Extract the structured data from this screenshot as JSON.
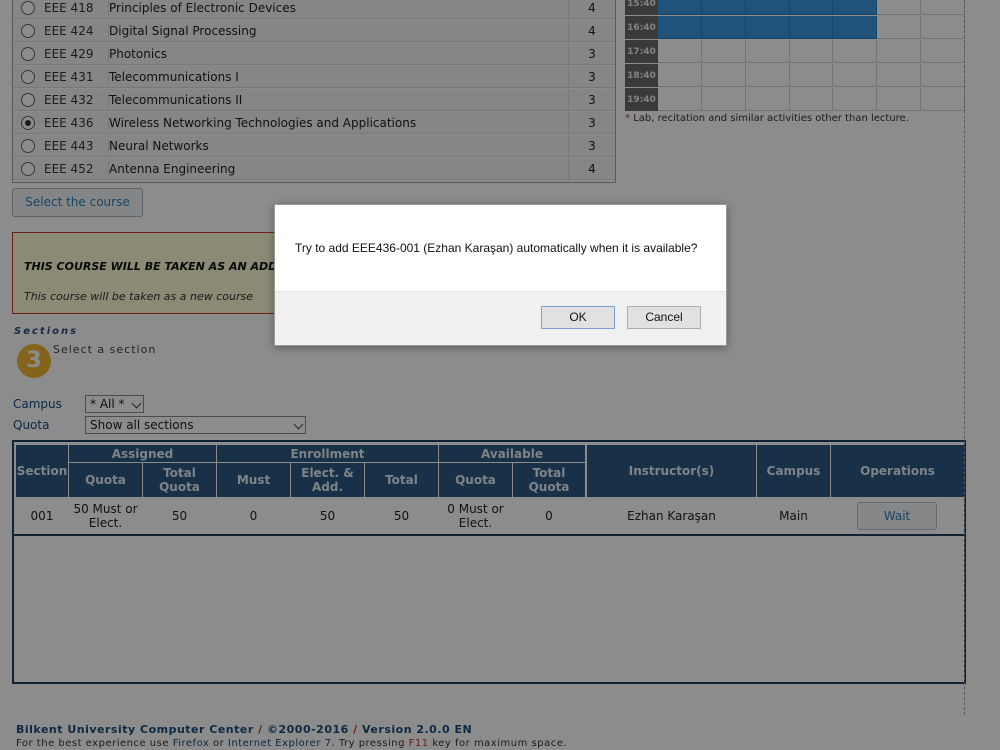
{
  "courses": [
    {
      "code": "EEE 418",
      "name": "Principles of Electronic Devices",
      "credit": "4",
      "selected": false
    },
    {
      "code": "EEE 424",
      "name": "Digital Signal Processing",
      "credit": "4",
      "selected": false
    },
    {
      "code": "EEE 429",
      "name": "Photonics",
      "credit": "3",
      "selected": false
    },
    {
      "code": "EEE 431",
      "name": "Telecommunications I",
      "credit": "3",
      "selected": false
    },
    {
      "code": "EEE 432",
      "name": "Telecommunications II",
      "credit": "3",
      "selected": false
    },
    {
      "code": "EEE 436",
      "name": "Wireless Networking Technologies and Applications",
      "credit": "3",
      "selected": true
    },
    {
      "code": "EEE 443",
      "name": "Neural Networks",
      "credit": "3",
      "selected": false
    },
    {
      "code": "EEE 452",
      "name": "Antenna Engineering",
      "credit": "4",
      "selected": false
    }
  ],
  "schedule": {
    "times": [
      "15:40",
      "16:40",
      "17:40",
      "18:40",
      "19:40"
    ],
    "busy_color": "#3b97e0",
    "busy_rows": [
      "15:40",
      "16:40"
    ],
    "lab_note_star": "*",
    "lab_note": "Lab, recitation and similar activities other than lecture."
  },
  "select_course_button": "Select the course",
  "warning": {
    "title": "THIS COURSE WILL BE TAKEN AS AN ADD",
    "subtitle": "This course will be taken as a new course"
  },
  "sections": {
    "title": "Sections",
    "step_number": "3",
    "step_label": "Select a section"
  },
  "filters": {
    "campus_label": "Campus",
    "campus_value": "* All *",
    "quota_label": "Quota",
    "quota_value": "Show all sections"
  },
  "table": {
    "headers": {
      "section": "Section",
      "assigned": "Assigned",
      "enrollment": "Enrollment",
      "available": "Available",
      "instructor": "Instructor(s)",
      "campus": "Campus",
      "operations": "Operations",
      "assigned_quota": "Quota",
      "assigned_total": "Total Quota",
      "enroll_must": "Must",
      "enroll_elect": "Elect. & Add.",
      "enroll_total": "Total",
      "avail_quota": "Quota",
      "avail_total": "Total Quota"
    },
    "rows": [
      {
        "section": "001",
        "assigned_quota": "50 Must or Elect.",
        "assigned_total": "50",
        "must": "0",
        "elect_add": "50",
        "total": "50",
        "avail_quota": "0 Must or Elect.",
        "avail_total": "0",
        "instructor": "Ezhan Karaşan",
        "campus": "Main",
        "operation": "Wait"
      }
    ]
  },
  "footer": {
    "center": "Bilkent University Computer Center",
    "sep": "/",
    "copyright": "©2000-2016",
    "version": "Version 2.0.0 EN",
    "hint_pre": "For the best experience use",
    "firefox": "Firefox",
    "or": "or",
    "ie": "Internet Explorer 7",
    "hint_mid": ". Try pressing",
    "key": "F11",
    "hint_post": "key for maximum space."
  },
  "dialog": {
    "message": "Try to add  EEE436-001 (Ezhan Karaşan) automatically when it is available?",
    "ok": "OK",
    "cancel": "Cancel"
  }
}
